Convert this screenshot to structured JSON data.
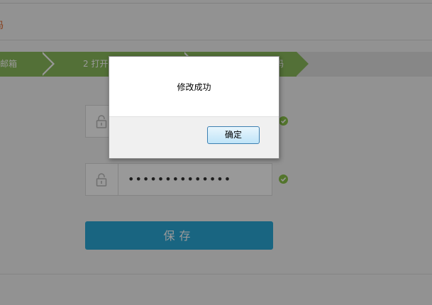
{
  "page": {
    "title": "码"
  },
  "steps": [
    {
      "label": "定邮箱"
    },
    {
      "label": "2 打开"
    },
    {
      "label": "码"
    }
  ],
  "form": {
    "password_masked": "••••••••••••••",
    "save_label": "保存"
  },
  "dialog": {
    "message": "修改成功",
    "ok_label": "确定"
  },
  "colors": {
    "accent_orange": "#e0672c",
    "step_green": "#8bbb5c",
    "save_blue": "#2aa8d8",
    "check_green": "#8bc34a"
  }
}
